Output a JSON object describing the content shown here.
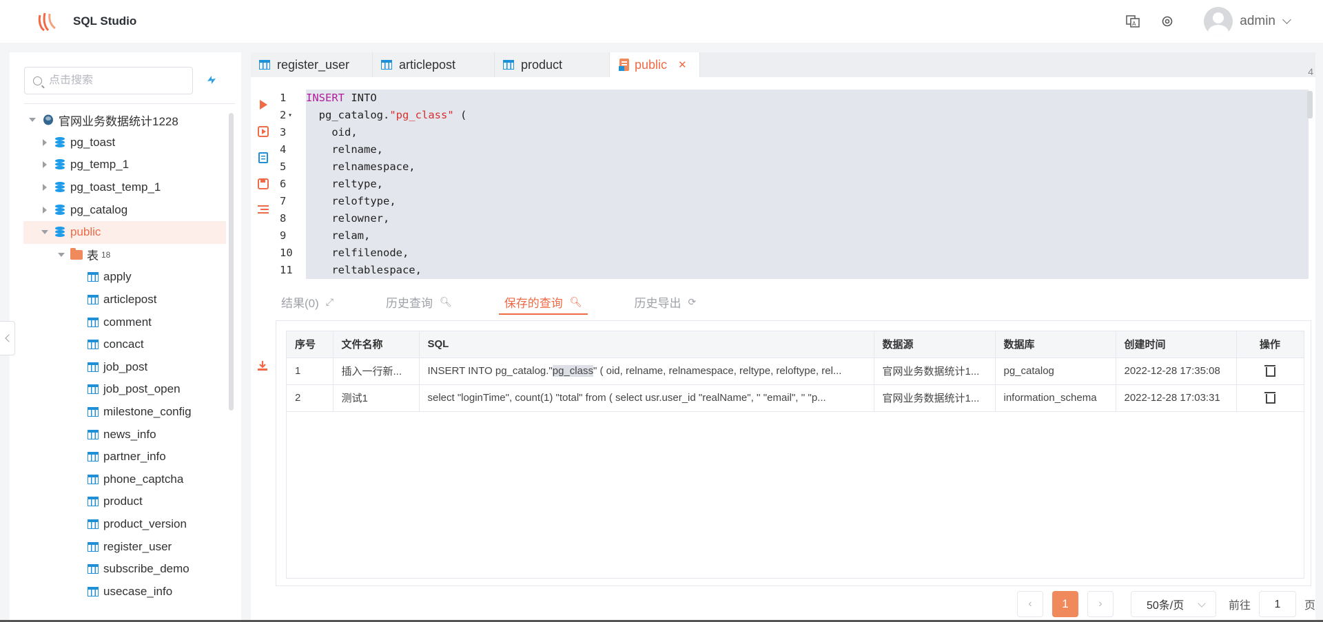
{
  "app": {
    "title": "SQL Studio"
  },
  "header": {
    "translate_icon": "translate-icon",
    "settings_icon": "settings-icon",
    "user_name": "admin"
  },
  "sidebar": {
    "search_placeholder": "点击搜索",
    "connection": "官网业务数据统计1228",
    "schemas": [
      "pg_toast",
      "pg_temp_1",
      "pg_toast_temp_1",
      "pg_catalog",
      "public"
    ],
    "active_schema": "public",
    "table_folder": {
      "label": "表",
      "count": "18"
    },
    "tables": [
      "apply",
      "articlepost",
      "comment",
      "concact",
      "job_post",
      "job_post_open",
      "milestone_config",
      "news_info",
      "partner_info",
      "phone_captcha",
      "product",
      "product_version",
      "register_user",
      "subscribe_demo",
      "usecase_info"
    ]
  },
  "tabs": [
    {
      "label": "register_user",
      "active": false
    },
    {
      "label": "articlepost",
      "active": false
    },
    {
      "label": "product",
      "active": false
    },
    {
      "label": "public",
      "active": true
    }
  ],
  "tab_count": "4",
  "editor": {
    "line_numbers": [
      "1",
      "2",
      "3",
      "4",
      "5",
      "6",
      "7",
      "8",
      "9",
      "10",
      "11"
    ],
    "lines": [
      "INSERT INTO",
      "  pg_catalog.\"pg_class\" (",
      "    oid,",
      "    relname,",
      "    relnamespace,",
      "    reltype,",
      "    reloftype,",
      "    relowner,",
      "    relam,",
      "    relfilenode,",
      "    reltablespace,"
    ]
  },
  "result_tabs": [
    {
      "label": "结果(0)",
      "active": false
    },
    {
      "label": "历史查询",
      "active": false
    },
    {
      "label": "保存的查询",
      "active": true
    },
    {
      "label": "历史导出",
      "active": false
    }
  ],
  "table": {
    "headers": [
      "序号",
      "文件名称",
      "SQL",
      "数据源",
      "数据库",
      "创建时间",
      "操作"
    ],
    "rows": [
      {
        "no": "1",
        "name": "插入一行新...",
        "sql_pre": "INSERT INTO pg_catalog.\"",
        "sql_hl": "pg_class",
        "sql_post": "\" ( oid, relname, relnamespace, reltype, reloftype, rel...",
        "source": "官网业务数据统计1...",
        "db": "pg_catalog",
        "created": "2022-12-28 17:35:08"
      },
      {
        "no": "2",
        "name": "测试1",
        "sql_pre": "select \"loginTime\", count(1) \"total\" from ( select usr.user_id \"realName\", '' \"email\", '' \"p...",
        "sql_hl": "",
        "sql_post": "",
        "source": "官网业务数据统计1...",
        "db": "information_schema",
        "created": "2022-12-28 17:03:31"
      }
    ]
  },
  "pagination": {
    "current": "1",
    "page_size": "50条/页",
    "goto_label": "前往",
    "goto_value": "1",
    "page_suffix": "页"
  },
  "colors": {
    "accent": "#ef6a45",
    "blue": "#1e9be9"
  }
}
